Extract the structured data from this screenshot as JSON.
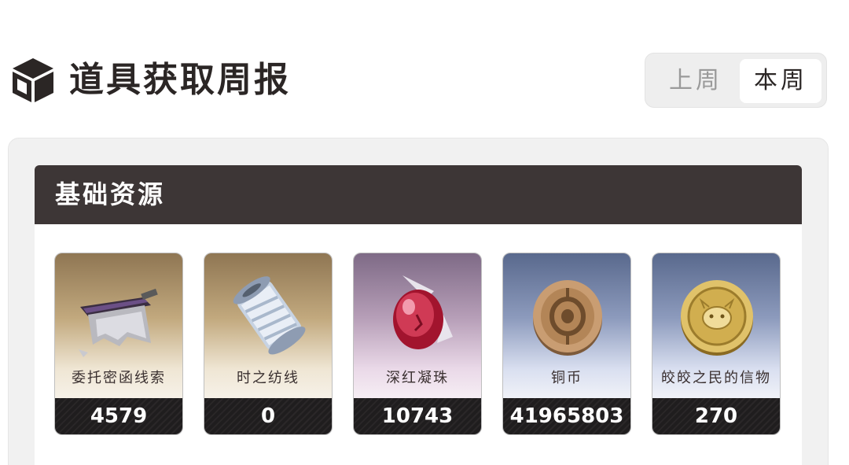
{
  "header": {
    "title": "道具获取周报",
    "icon": "cube-icon"
  },
  "week_toggle": {
    "previous_label": "上周",
    "current_label": "本周",
    "selected": "本周"
  },
  "section": {
    "title": "基础资源"
  },
  "items": [
    {
      "name": "委托密函线索",
      "count": "4579",
      "icon": "scroll-icon",
      "bg": "gold"
    },
    {
      "name": "时之纺线",
      "count": "0",
      "icon": "thread-spool-icon",
      "bg": "gold"
    },
    {
      "name": "深红凝珠",
      "count": "10743",
      "icon": "crimson-orb-icon",
      "bg": "purple"
    },
    {
      "name": "铜币",
      "count": "41965803",
      "icon": "copper-coin-icon",
      "bg": "blue"
    },
    {
      "name": "皎皎之民的信物",
      "count": "270",
      "icon": "gold-token-icon",
      "bg": "blue"
    }
  ],
  "colors": {
    "header_bar": "#3d3636",
    "title_text": "#2b2625",
    "toggle_inactive_text": "#9a9a9a"
  }
}
